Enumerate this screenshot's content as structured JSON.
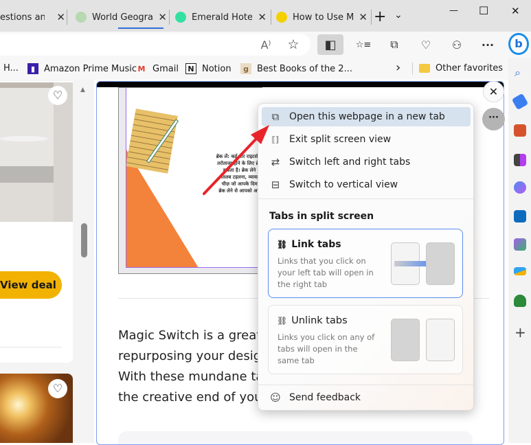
{
  "tabs": [
    {
      "title": "estions and",
      "close": "✕"
    },
    {
      "title": "World Geograp",
      "close": "✕"
    },
    {
      "title": "Emerald Hotel",
      "close": "✕"
    },
    {
      "title": "How to Use M",
      "close": "✕"
    }
  ],
  "tabbar": {
    "new_tab": "+",
    "tab_actions": "⌄"
  },
  "window": {
    "minimize": "—",
    "maximize": "☐",
    "close": "✕"
  },
  "toolbar": {
    "read_aloud": "A⁾",
    "favorite": "☆",
    "split_screen": "◧",
    "favorites": "☆≡",
    "collections": "⧉",
    "health": "♡",
    "extensions": "⚇",
    "more": "···"
  },
  "bookmarks": [
    {
      "label": "H...",
      "icon": ""
    },
    {
      "label": "Amazon Prime Music",
      "icon": "▮"
    },
    {
      "label": "Gmail",
      "icon": "M"
    },
    {
      "label": "Notion",
      "icon": "N"
    },
    {
      "label": "Best Books of the 2...",
      "icon": "g"
    }
  ],
  "bookmarks_more": "›",
  "other_favorites": "Other favorites",
  "left_pane": {
    "view_deal": "View deal",
    "heart": "♡"
  },
  "right_pane": {
    "close": "✕",
    "more": "···",
    "hindi_text": "ब्रेक लें: कई बार राइटर्स ब्लॉक थ\nतरोताजा होने के लिए ब्रेक लें। ले\nसकता है। ब्रेक लेने और आरा\nमतलब टहलना, व्यायाम करना,\nचीज़ जो आपके दिमाग को सा\nब्रेक लेने से आपको अपना ध्यान\nदृष्टि",
    "paragraph": [
      "Magic Switch is a great t",
      "repurposing your design",
      "With these mundane tas",
      "the creative end of your"
    ]
  },
  "menu": {
    "items": [
      {
        "label": "Open this webpage in a new tab",
        "icon": "⧉"
      },
      {
        "label": "Exit split screen view",
        "icon": "⟦⟧"
      },
      {
        "label": "Switch left and right tabs",
        "icon": "⇄"
      },
      {
        "label": "Switch to vertical view",
        "icon": "⊟"
      }
    ],
    "section_title": "Tabs in split screen",
    "link": {
      "title": "Link tabs",
      "desc": "Links that you click on your left tab will open in the right tab"
    },
    "unlink": {
      "title": "Unlink tabs",
      "desc": "Links you click on any of tabs will open in the same tab"
    },
    "feedback": "Send feedback"
  },
  "colors": {
    "accent": "#2f6fd6",
    "view_deal": "#f2b203",
    "arrow": "#e8232a",
    "selected_item": "#d6e2ee"
  }
}
